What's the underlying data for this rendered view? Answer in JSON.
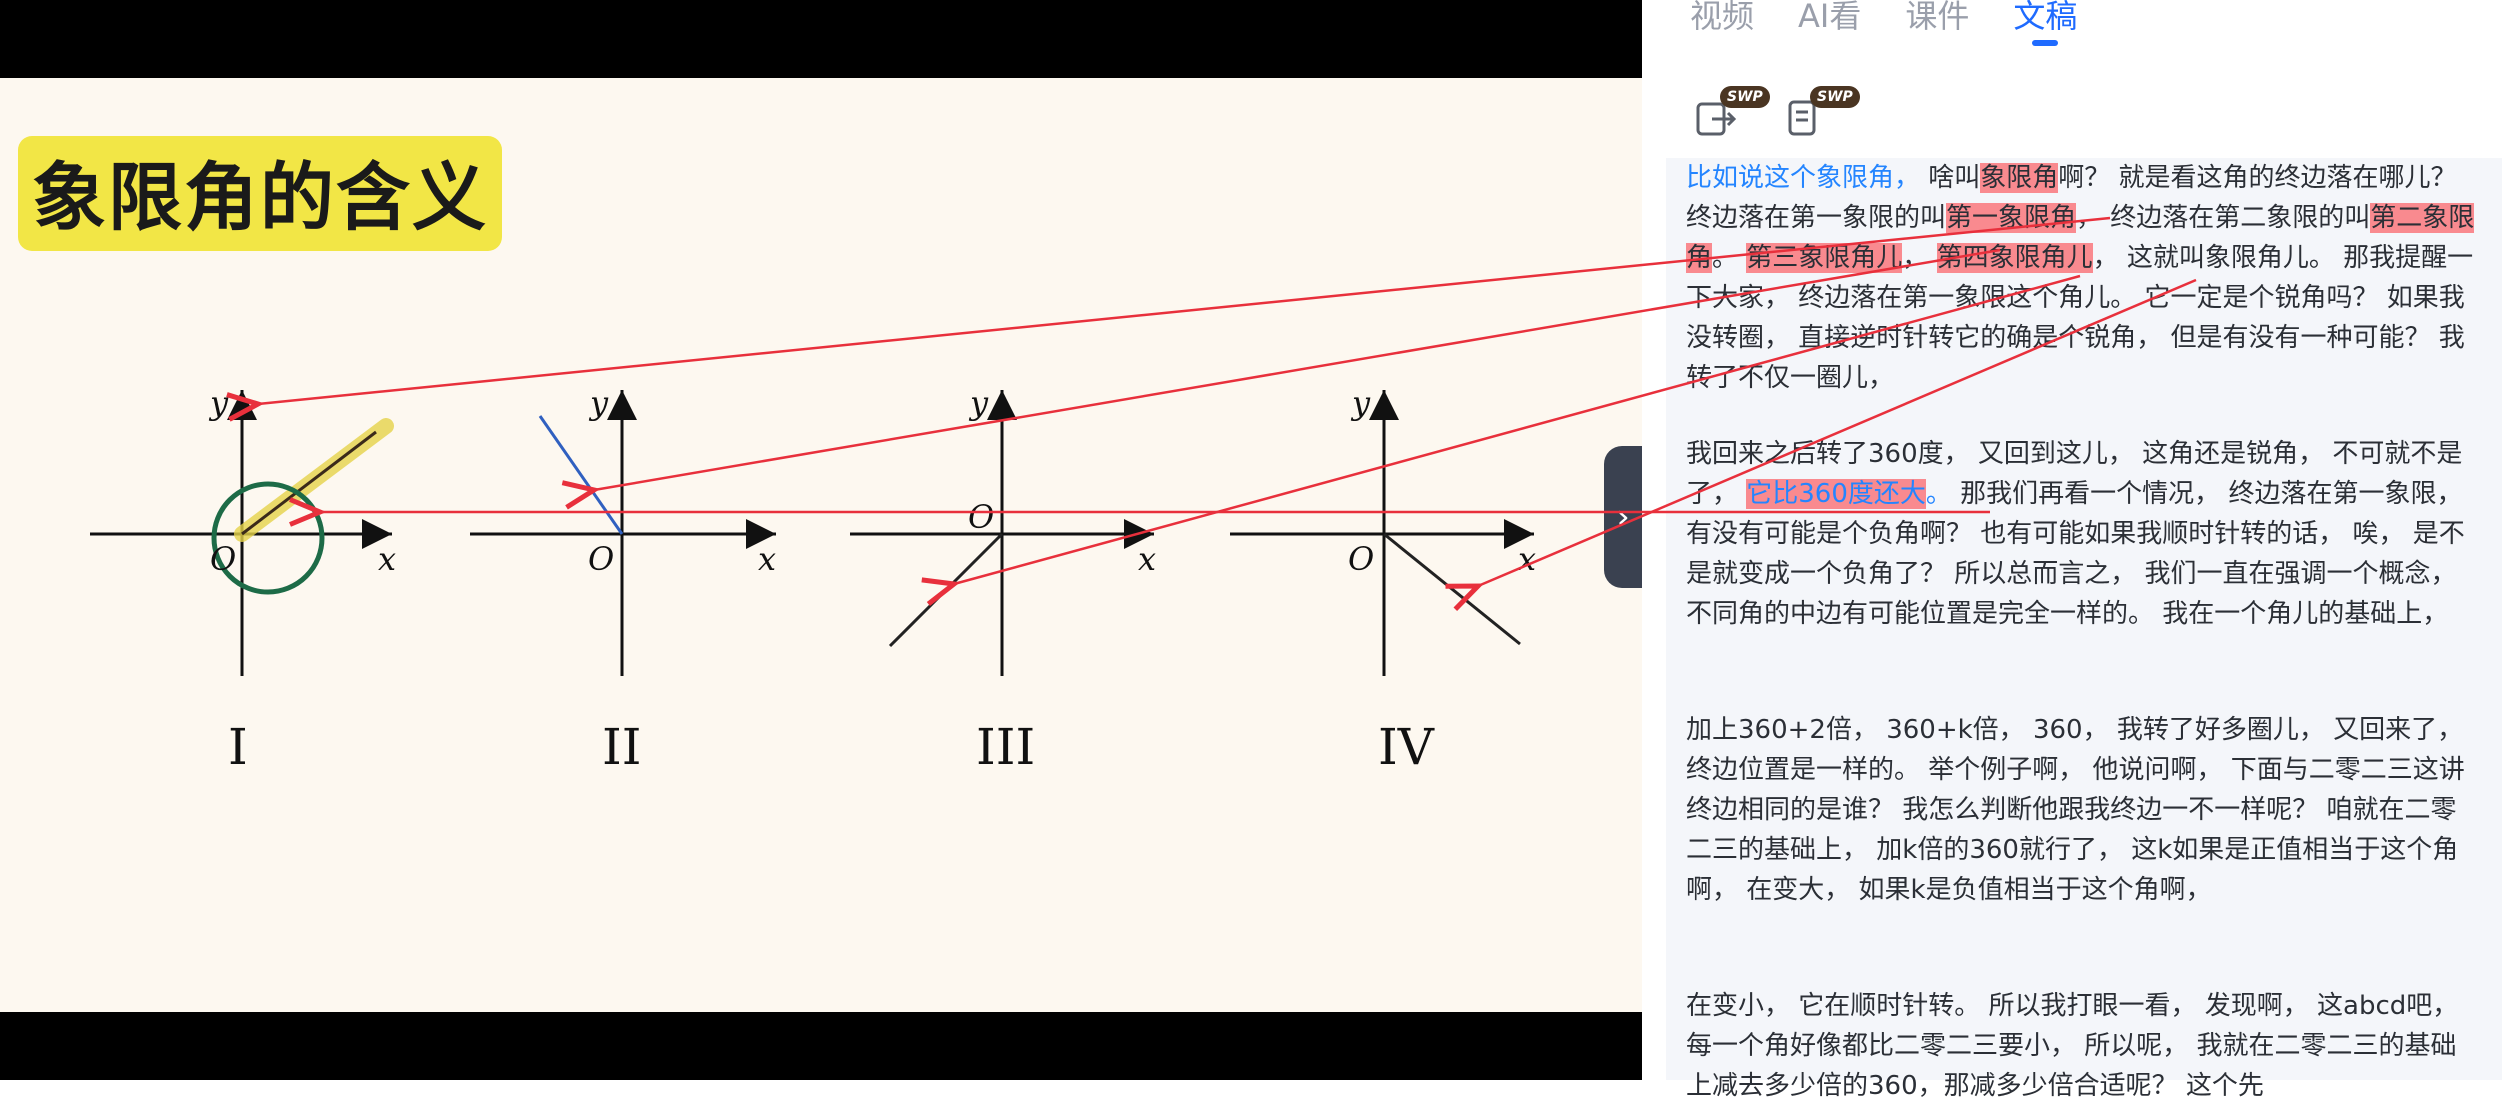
{
  "slide": {
    "title": "象限角的含义",
    "axis_x": "x",
    "axis_y": "y",
    "origin": "O",
    "quadrants": [
      "I",
      "II",
      "III",
      "IV"
    ]
  },
  "panel": {
    "tabs": [
      {
        "label": "视频",
        "active": false
      },
      {
        "label": "AI看",
        "active": false
      },
      {
        "label": "课件",
        "active": false
      },
      {
        "label": "文稿",
        "active": true
      }
    ],
    "tools": [
      {
        "icon": "export-icon",
        "badge": "SWP"
      },
      {
        "icon": "document-icon",
        "badge": "SWP"
      }
    ],
    "side_toggle": "expand-chevron-icon"
  },
  "transcript": {
    "p1": {
      "s1": "比如说这个象限角，",
      "s2": "  啥叫",
      "s3": "象限角",
      "s4": "啊？ 就是看这角的终边落在哪儿？ 终边落在第一象限的叫",
      "s5": "第一象限角",
      "s6": "， 终边落在第二象限的叫",
      "s7": "第二象限角",
      "s8": "。 ",
      "s9": "第三象限角儿",
      "s10": "， ",
      "s11": "第四象限角儿",
      "s12": "， 这就叫象限角儿。 那我提醒一下大家， 终边落在第一象限这个角儿。 它一定是个锐角吗？ 如果我没转圈， 直接逆时针转它的确是个锐角， 但是有没有一种可能？ 我转了不仅一圈儿，"
    },
    "p2": {
      "s1": "我回来之后转了360度， 又回到这儿， 这角还是锐角， 不可就不是了， ",
      "s2": "它比360度还大",
      "s3": "。",
      "s4": " 那我们再看一个情况， 终边落在第一象限， 有没有可能是个负角啊？ 也有可能如果我顺时针转的话， 唉， 是不是就变成一个负角了？ 所以总而言之， 我们一直在强调一个概念， 不同角的中边有可能位置是完全一样的。 我在一个角儿的基础上，"
    },
    "p3": "加上360+2倍， 360+k倍， 360， 我转了好多圈儿， 又回来了， 终边位置是一样的。 举个例子啊， 他说问啊， 下面与二零二三这讲终边相同的是谁？ 我怎么判断他跟我终边一不一样呢？ 咱就在二零二三的基础上， 加k倍的360就行了， 这k如果是正值相当于这个角啊， 在变大， 如果k是负值相当于这个角啊，",
    "p4": "在变小， 它在顺时针转。 所以我打眼一看， 发现啊， 这abcd吧， 每一个角好像都比二零二三要小， 所以呢， 我就在二零二三的基础上减去多少倍的360，那减多少倍合适呢？ 这个先"
  },
  "colors": {
    "accent": "#1f6bff",
    "highlight": "#f98a8f",
    "annotation": "#e8303c",
    "title_bg": "#f2e646"
  }
}
